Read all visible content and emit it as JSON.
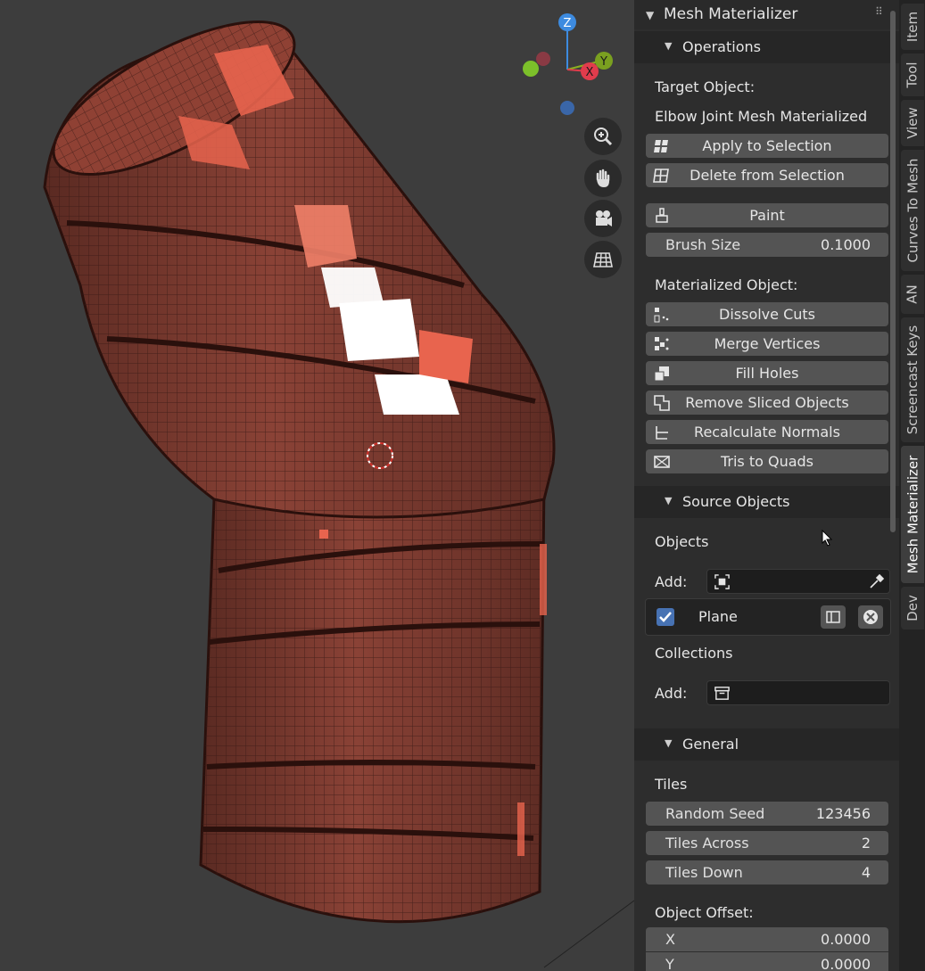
{
  "viewport": {
    "gizmo": {
      "z": "Z",
      "y": "Y",
      "x": "X"
    },
    "nav_icons": [
      "zoom-icon",
      "hand-pan-icon",
      "camera-icon",
      "grid-ortho-icon"
    ]
  },
  "sidebar": {
    "panel_title": "Mesh Materializer",
    "operations": {
      "title": "Operations",
      "target_object_label": "Target Object:",
      "target_object_name": "Elbow Joint Mesh Materialized",
      "apply_label": "Apply to Selection",
      "delete_label": "Delete from Selection",
      "paint_label": "Paint",
      "brush_size_label": "Brush Size",
      "brush_size_value": "0.1000",
      "materialized_label": "Materialized Object:",
      "dissolve_label": "Dissolve Cuts",
      "merge_label": "Merge Vertices",
      "fill_label": "Fill Holes",
      "remove_label": "Remove Sliced Objects",
      "recalc_label": "Recalculate Normals",
      "tris_label": "Tris to Quads"
    },
    "source": {
      "title": "Source Objects",
      "objects_label": "Objects",
      "add_label": "Add:",
      "plane_label": "Plane",
      "plane_checked": true,
      "collections_label": "Collections",
      "add_label_2": "Add:"
    },
    "general": {
      "title": "General",
      "tiles_label": "Tiles",
      "seed_label": "Random Seed",
      "seed_value": "123456",
      "across_label": "Tiles Across",
      "across_value": "2",
      "down_label": "Tiles Down",
      "down_value": "4",
      "offset_label": "Object Offset:",
      "x_label": "X",
      "x_value": "0.0000",
      "y_label": "Y",
      "y_value": "0.0000"
    }
  },
  "tabs": [
    "Item",
    "Tool",
    "View",
    "Curves To Mesh",
    "AN",
    "Screencast Keys",
    "Mesh Materializer",
    "Dev"
  ],
  "active_tab": "Mesh Materializer",
  "colors": {
    "viewport_bg": "#3d3d3d",
    "mesh": "#7a3a30",
    "mesh_highlight": "#e8644e",
    "sidebar_bg": "#2d2d2d",
    "button": "#545454",
    "checkbox": "#4772b3"
  }
}
